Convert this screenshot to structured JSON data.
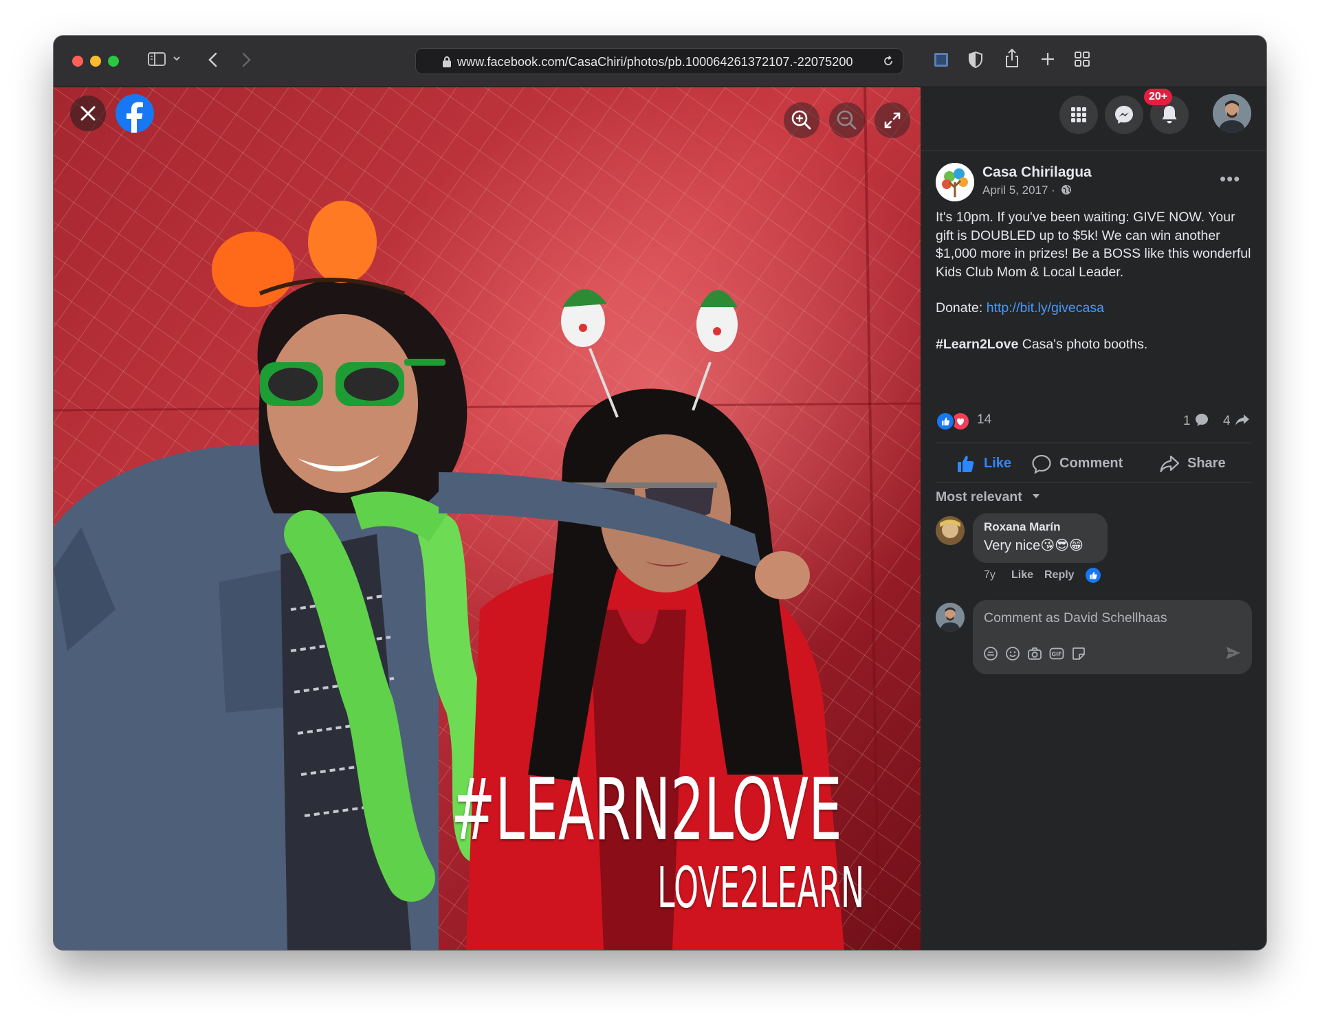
{
  "browser": {
    "url": "www.facebook.com/CasaChiri/photos/pb.100064261372107.-22075200"
  },
  "photo": {
    "overlay_line1": "#LEARN2LOVE",
    "overlay_line2": "LOVE2LEARN"
  },
  "header": {
    "notifications_badge": "20+"
  },
  "post": {
    "page_name": "Casa Chirilagua",
    "date": "April 5, 2017 ·",
    "text_para1": "It's 10pm. If you've been waiting: GIVE NOW. Your gift is DOUBLED up to $5k! We can win another $1,000 more in prizes! Be a BOSS like this wonderful Kids Club Mom & Local Leader.",
    "donate_label": "Donate: ",
    "donate_link": "http://bit.ly/givecasa",
    "hashtag": "#Learn2Love",
    "hashtag_rest": " Casa's photo booths.",
    "reaction_count": "14",
    "comment_count": "1",
    "share_count": "4"
  },
  "actions": {
    "like": "Like",
    "comment": "Comment",
    "share": "Share"
  },
  "comments": {
    "sort_label": "Most relevant",
    "items": [
      {
        "author": "Roxana Marín",
        "text": "Very nice😘😎😁",
        "age": "7y",
        "like": "Like",
        "reply": "Reply"
      }
    ],
    "composer_placeholder": "Comment as David Schellhaas"
  },
  "colors": {
    "facebook_blue": "#1877f2",
    "link_blue": "#4599ff",
    "panel_bg": "#242526",
    "badge_red": "#e41e3f"
  },
  "icons": [
    "close-icon",
    "facebook-logo-icon",
    "zoom-in-icon",
    "zoom-out-icon",
    "fullscreen-icon",
    "menu-grid-icon",
    "messenger-icon",
    "bell-icon",
    "globe-icon",
    "like-icon",
    "love-icon",
    "comment-icon",
    "share-icon",
    "avatar-sticker-icon",
    "emoji-icon",
    "camera-icon",
    "gif-icon",
    "sticker-icon",
    "send-icon"
  ]
}
